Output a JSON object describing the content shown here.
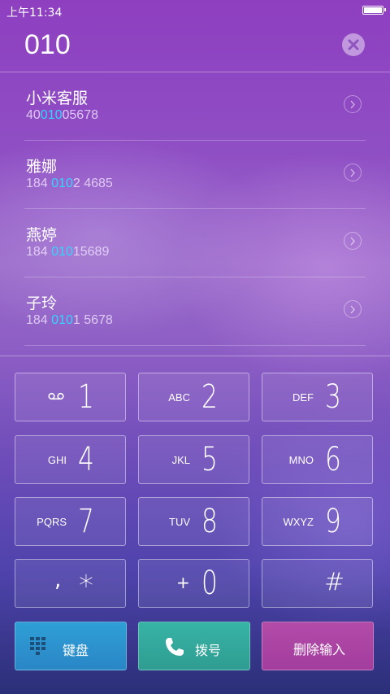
{
  "status_bar": {
    "time": "上午11:34"
  },
  "dialer": {
    "number": "010"
  },
  "contacts": [
    {
      "name": "小米客服",
      "number_pre": "40",
      "number_match": "010",
      "number_post": "05678"
    },
    {
      "name": "雅娜",
      "number_pre": "184 ",
      "number_match": "010",
      "number_post": "2 4685"
    },
    {
      "name": "燕婷",
      "number_pre": "184 ",
      "number_match": "010",
      "number_post": "15689"
    },
    {
      "name": "子玲",
      "number_pre": "184 ",
      "number_match": "010",
      "number_post": "1 5678"
    }
  ],
  "keypad": {
    "k1": {
      "digit": "1",
      "letters": "",
      "icon": "voicemail-icon"
    },
    "k2": {
      "digit": "2",
      "letters": "ABC"
    },
    "k3": {
      "digit": "3",
      "letters": "DEF"
    },
    "k4": {
      "digit": "4",
      "letters": "GHI"
    },
    "k5": {
      "digit": "5",
      "letters": "JKL"
    },
    "k6": {
      "digit": "6",
      "letters": "MNO"
    },
    "k7": {
      "digit": "7",
      "letters": "PQRS"
    },
    "k8": {
      "digit": "8",
      "letters": "TUV"
    },
    "k9": {
      "digit": "9",
      "letters": "WXYZ"
    },
    "kstar": {
      "left": ",",
      "right": "*"
    },
    "k0": {
      "left": "+",
      "right": "0"
    },
    "khash": {
      "right": "#"
    }
  },
  "actions": {
    "keyboard_label": "键盘",
    "call_label": "拨号",
    "delete_label": "删除输入"
  },
  "colors": {
    "match_highlight": "#33d4ff",
    "keyboard_button": "#2f9fd6",
    "call_button": "#37b4a6",
    "delete_button": "#b24ba8"
  }
}
